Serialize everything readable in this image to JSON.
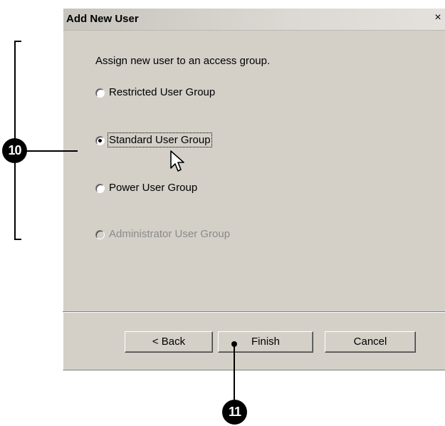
{
  "dialog": {
    "title": "Add New User",
    "close_glyph": "×",
    "prompt": "Assign new user to an access group.",
    "options": [
      {
        "label": "Restricted User Group",
        "selected": false,
        "enabled": true
      },
      {
        "label": "Standard User Group",
        "selected": true,
        "enabled": true
      },
      {
        "label": "Power User Group",
        "selected": false,
        "enabled": true
      },
      {
        "label": "Administrator User Group",
        "selected": false,
        "enabled": false
      }
    ],
    "buttons": {
      "back": "< Back",
      "finish": "Finish",
      "cancel": "Cancel"
    }
  },
  "callouts": {
    "group_options": "10",
    "finish": "11"
  },
  "colors": {
    "dialog_bg": "#d4d0c8",
    "callout": "#000000"
  }
}
